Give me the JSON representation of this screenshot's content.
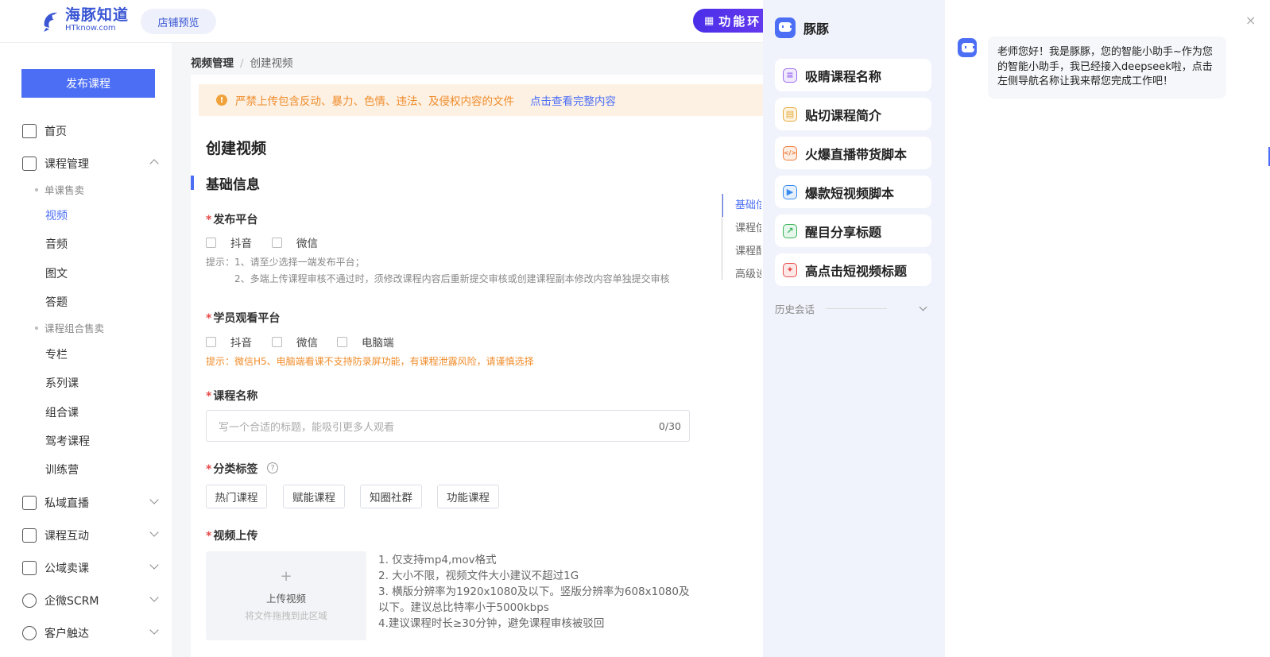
{
  "header": {
    "logo_cn": "海豚知道",
    "logo_en": "HTknow.com",
    "shop_preview": "店铺预览",
    "func_button": "功能环"
  },
  "sidebar": {
    "publish_button": "发布课程",
    "home": "首页",
    "course_mgmt": "课程管理",
    "group_single": "单课售卖",
    "video": "视频",
    "audio": "音频",
    "article": "图文",
    "quiz": "答题",
    "group_combo": "课程组合售卖",
    "column": "专栏",
    "series": "系列课",
    "combo": "组合课",
    "driving": "驾考课程",
    "camp": "训练营",
    "private_live": "私域直播",
    "interaction": "课程互动",
    "public_sale": "公域卖课",
    "scrm": "企微SCRM",
    "customer": "客户触达"
  },
  "breadcrumb": {
    "parent": "视频管理",
    "sep": "/",
    "current": "创建视频"
  },
  "warning": {
    "icon": "!",
    "text": "严禁上传包含反动、暴力、色情、违法、及侵权内容的文件",
    "link": "点击查看完整内容"
  },
  "form": {
    "page_title": "创建视频",
    "section_title": "基础信息",
    "required_mark": "*",
    "publish_platform_label": "发布平台",
    "publish_platforms": [
      "抖音",
      "微信"
    ],
    "publish_hint_1": "提示：1、请至少选择一端发布平台；",
    "publish_hint_2": "2、多端上传课程审核不通过时，须修改课程内容后重新提交审核或创建课程副本修改内容单独提交审核",
    "watch_platform_label": "学员观看平台",
    "watch_platforms": [
      "抖音",
      "微信",
      "电脑端"
    ],
    "watch_hint": "提示：微信H5、电脑端看课不支持防录屏功能，有课程泄露风险，请谨慎选择",
    "course_name_label": "课程名称",
    "course_name_placeholder": "写一个合适的标题，能吸引更多人观看",
    "course_name_count": "0/30",
    "category_label": "分类标签",
    "help_icon": "?",
    "tags": [
      "热门课程",
      "赋能课程",
      "知圈社群",
      "功能课程"
    ],
    "upload_label": "视频上传",
    "upload_plus": "+",
    "upload_title": "上传视频",
    "upload_sub": "将文件拖拽到此区域",
    "upload_notes": [
      "1. 仅支持mp4,mov格式",
      "2. 大小不限，视频文件大小建议不超过1G",
      "3. 横版分辨率为1920x1080及以下。竖版分辨率为608x1080及以下。建议总比特率小于5000kbps",
      "4.建议课程时长≥30分钟，避免课程审核被驳回"
    ]
  },
  "anchor_nav": [
    "基础信息",
    "课程信息",
    "课程配置",
    "高级设置"
  ],
  "assistant": {
    "name": "豚豚",
    "buttons": [
      {
        "label": "吸睛课程名称",
        "icon": "≡",
        "color": "#9b6cf0",
        "bg": "#f1eafd"
      },
      {
        "label": "贴切课程简介",
        "icon": "▤",
        "color": "#e8a93a",
        "bg": "#fdf4e2"
      },
      {
        "label": "火爆直播带货脚本",
        "icon": "</>",
        "color": "#f07a3a",
        "bg": "#fdeee4"
      },
      {
        "label": "爆款短视频脚本",
        "icon": "▶",
        "color": "#3a8bf0",
        "bg": "#e6f0fd"
      },
      {
        "label": "醒目分享标题",
        "icon": "↗",
        "color": "#3ab35a",
        "bg": "#e5f6ea"
      },
      {
        "label": "高点击短视频标题",
        "icon": "✦",
        "color": "#e84a4a",
        "bg": "#fde8e8"
      }
    ],
    "history": "历史会话",
    "close": "×",
    "message": "老师您好！我是豚豚，您的智能小助手~作为您的智能小助手，我已经接入deepseek啦，点击左侧导航名称让我来帮您完成工作吧！"
  }
}
